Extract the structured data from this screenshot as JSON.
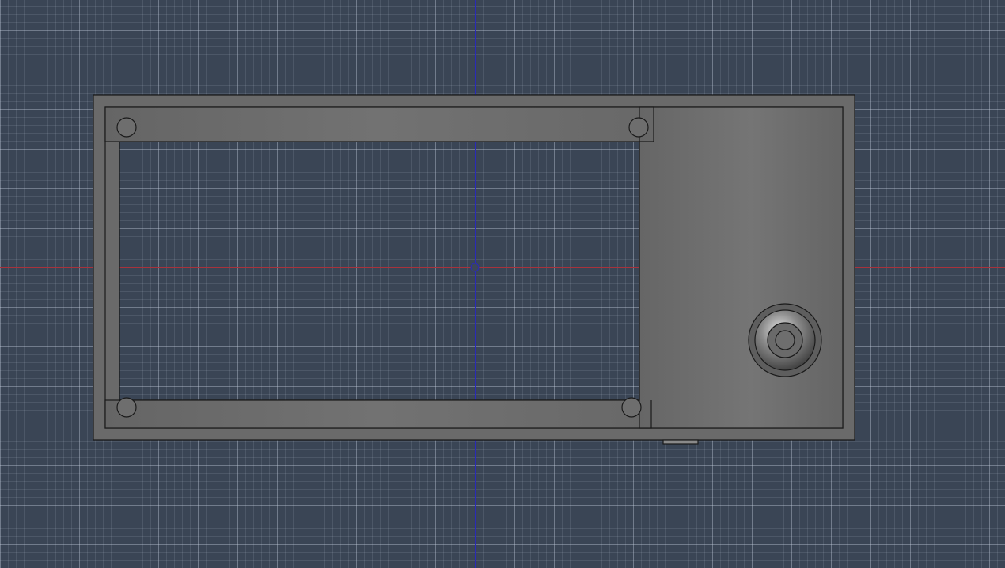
{
  "viewport": {
    "type": "3d-cad-top-view",
    "background": "#3a4555",
    "grid": true,
    "axes": {
      "x_axis_color": "#a8323c",
      "y_axis_color": "#2a2ab8"
    }
  },
  "model": {
    "body_color": "#6c6c6c",
    "edge_color": "#1a1a1a",
    "features": [
      "outer-frame",
      "inner-cavity",
      "top-rail",
      "bottom-rail",
      "side-panel",
      "mounting-hole",
      "button-boss",
      "tab"
    ]
  }
}
